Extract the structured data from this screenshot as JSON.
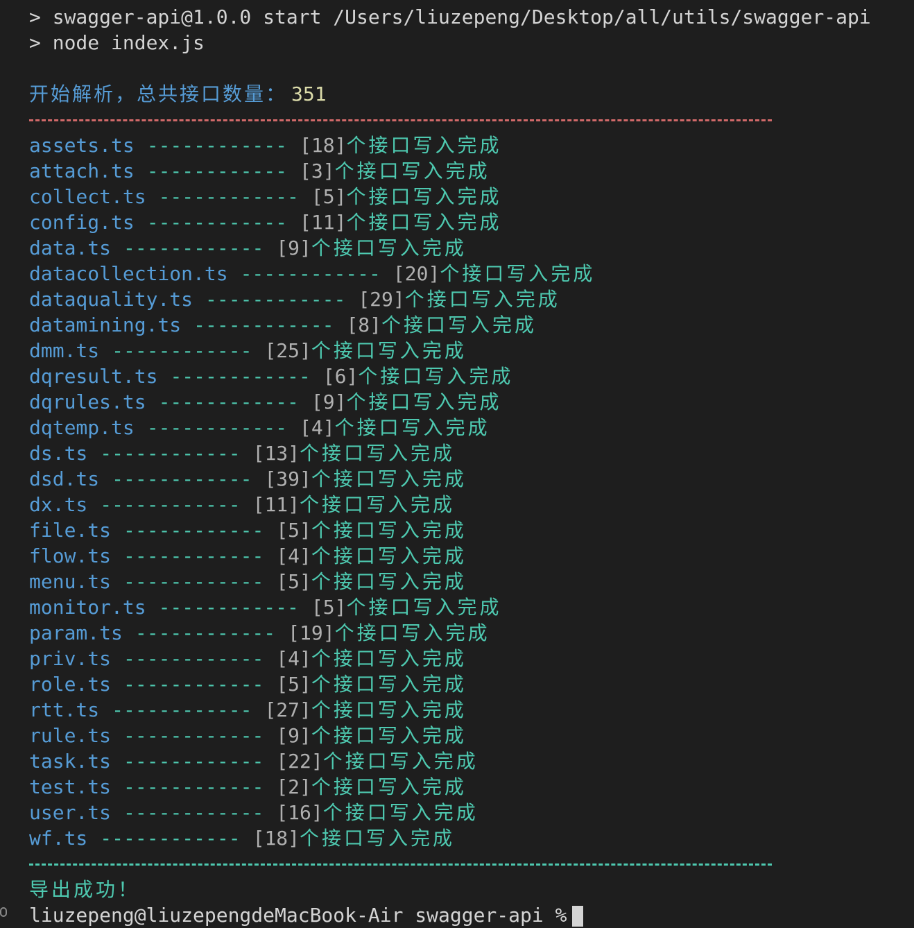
{
  "command_lines": [
    "> swagger-api@1.0.0 start /Users/liuzepeng/Desktop/all/utils/swagger-api",
    "> node index.js"
  ],
  "summary": {
    "label": "开始解析，总共接口数量：",
    "total": "351"
  },
  "rows": [
    {
      "file": "assets.ts",
      "count": "[18]"
    },
    {
      "file": "attach.ts",
      "count": "[3]"
    },
    {
      "file": "collect.ts",
      "count": "[5]"
    },
    {
      "file": "config.ts",
      "count": "[11]"
    },
    {
      "file": "data.ts",
      "count": "[9]"
    },
    {
      "file": "datacollection.ts",
      "count": "[20]"
    },
    {
      "file": "dataquality.ts",
      "count": "[29]"
    },
    {
      "file": "datamining.ts",
      "count": "[8]"
    },
    {
      "file": "dmm.ts",
      "count": "[25]"
    },
    {
      "file": "dqresult.ts",
      "count": "[6]"
    },
    {
      "file": "dqrules.ts",
      "count": "[9]"
    },
    {
      "file": "dqtemp.ts",
      "count": "[4]"
    },
    {
      "file": "ds.ts",
      "count": "[13]"
    },
    {
      "file": "dsd.ts",
      "count": "[39]"
    },
    {
      "file": "dx.ts",
      "count": "[11]"
    },
    {
      "file": "file.ts",
      "count": "[5]"
    },
    {
      "file": "flow.ts",
      "count": "[4]"
    },
    {
      "file": "menu.ts",
      "count": "[5]"
    },
    {
      "file": "monitor.ts",
      "count": "[5]"
    },
    {
      "file": "param.ts",
      "count": "[19]"
    },
    {
      "file": "priv.ts",
      "count": "[4]"
    },
    {
      "file": "role.ts",
      "count": "[5]"
    },
    {
      "file": "rtt.ts",
      "count": "[27]"
    },
    {
      "file": "rule.ts",
      "count": "[9]"
    },
    {
      "file": "task.ts",
      "count": "[22]"
    },
    {
      "file": "test.ts",
      "count": "[2]"
    },
    {
      "file": "user.ts",
      "count": "[16]"
    },
    {
      "file": "wf.ts",
      "count": "[18]"
    }
  ],
  "row_dashes": "------------",
  "row_suffix": "个接口写入完成",
  "success_text": "导出成功！",
  "prompt_text": "liuzepeng@liuzepengdeMacBook-Air swagger-api %",
  "colors": {
    "background": "#1e1e1e",
    "text": "#d4d4d4",
    "blue": "#569cd6",
    "green": "#4ec9b0",
    "yellow": "#dcdcaa",
    "red": "#d16969"
  }
}
